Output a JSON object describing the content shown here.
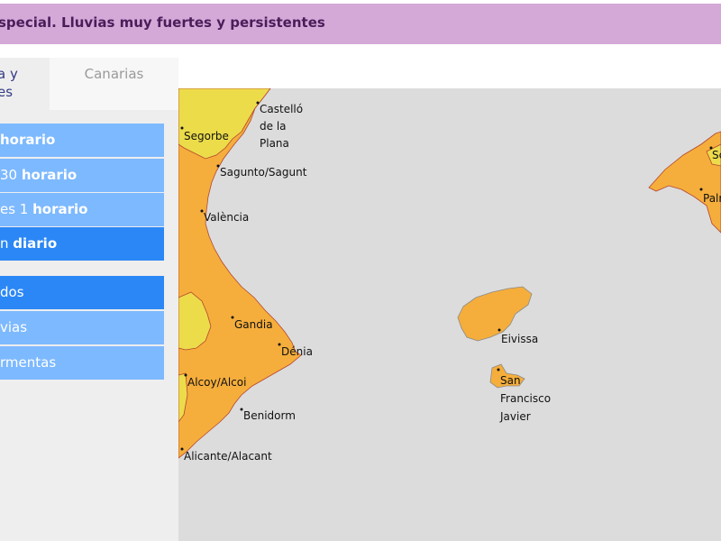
{
  "banner": {
    "text": "special. Lluvias muy fuertes y persistentes"
  },
  "tabs": [
    {
      "label": "a y\nes"
    },
    {
      "label": "Canarias"
    }
  ],
  "menu": {
    "items": [
      {
        "prefix": "",
        "bold": "horario"
      },
      {
        "prefix": "30 ",
        "bold": "horario"
      },
      {
        "prefix": "es 1 ",
        "bold": "horario"
      },
      {
        "prefix": "n ",
        "bold": "diario"
      }
    ],
    "sub_items": [
      "dos",
      "vias",
      "rmentas"
    ]
  },
  "map": {
    "colors": {
      "sea": "#dcdcdc",
      "orange_warning": "#f5ae3c",
      "yellow_warning": "#ecdc4a",
      "border": "#b5452e"
    },
    "cities": [
      "Castelló de la Plana",
      "Segorbe",
      "Sagunto/Sagunt",
      "València",
      "Gandia",
      "Dénia",
      "Alcoy/Alcoi",
      "Benidorm",
      "Alicante/Alacant",
      "Eivissa",
      "San Francisco Javier",
      "Palma",
      "Sóller"
    ],
    "city_lines": {
      "castello": [
        "Castelló",
        "de la",
        "Plana"
      ],
      "san_francisco": [
        "San",
        "Francisco",
        "Javier"
      ],
      "palma": "Palr",
      "soller": "Sc"
    }
  }
}
